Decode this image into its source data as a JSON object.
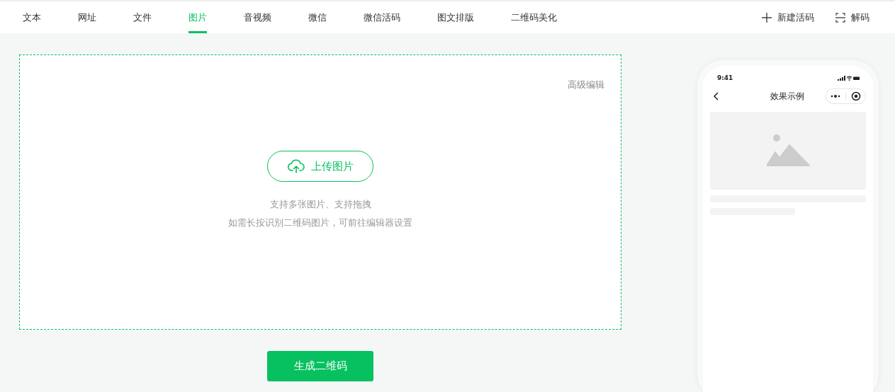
{
  "tabs": [
    {
      "label": "文本",
      "selected": false
    },
    {
      "label": "网址",
      "selected": false
    },
    {
      "label": "文件",
      "selected": false
    },
    {
      "label": "图片",
      "selected": true
    },
    {
      "label": "音视频",
      "selected": false
    },
    {
      "label": "微信",
      "selected": false
    },
    {
      "label": "微信活码",
      "selected": false
    },
    {
      "label": "图文排版",
      "selected": false
    },
    {
      "label": "二维码美化",
      "selected": false
    }
  ],
  "actions": [
    {
      "kind": "new",
      "label": "新建活码"
    },
    {
      "kind": "decode",
      "label": "解码"
    }
  ],
  "upload": {
    "advanced_link": "高级编辑",
    "button": "上传图片",
    "hints": [
      "支持多张图片、支持拖拽",
      "如需长按识别二维码图片，可前往编辑器设置"
    ]
  },
  "generate_button": "生成二维码",
  "phone": {
    "time": "9:41",
    "title": "效果示例"
  }
}
